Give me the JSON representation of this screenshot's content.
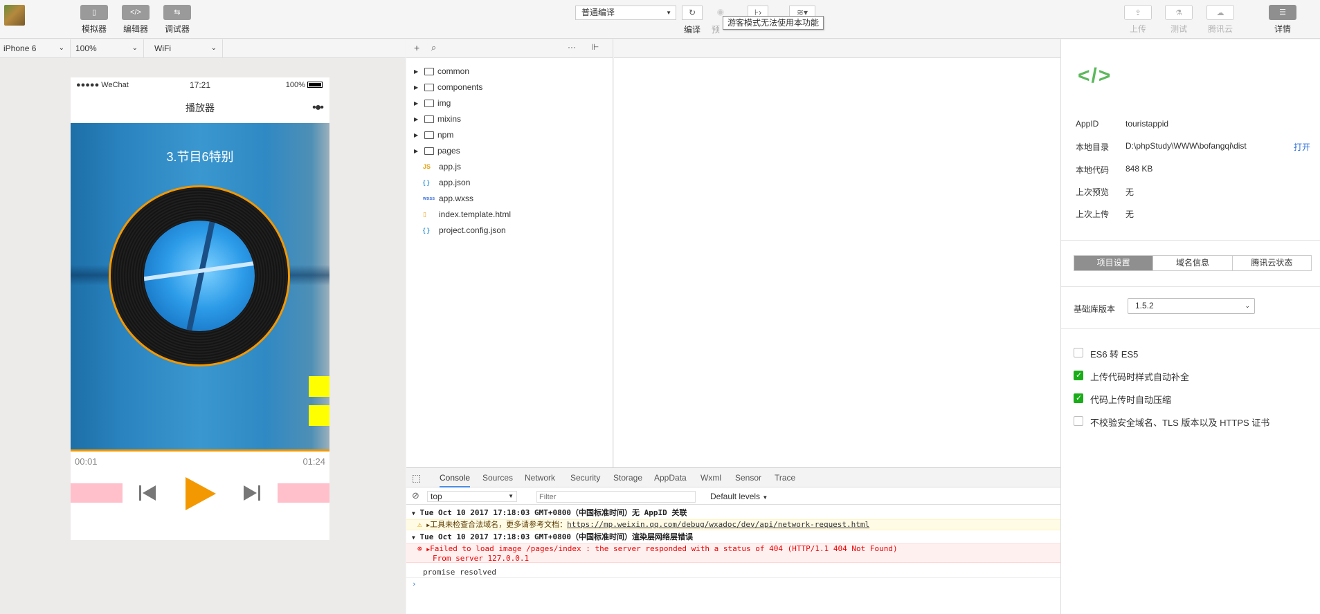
{
  "toolbar": {
    "left_buttons": [
      {
        "label": "模拟器",
        "glyph": "▯"
      },
      {
        "label": "编辑器",
        "glyph": "</>"
      },
      {
        "label": "调试器",
        "glyph": "⇆"
      }
    ],
    "mode_select": "普通编译",
    "compile_label": "编译",
    "preview_label_partial": "预",
    "tooltip": "游客模式无法使用本功能",
    "right_buttons": [
      {
        "label": "上传",
        "enabled": false
      },
      {
        "label": "测试",
        "enabled": false
      },
      {
        "label": "腾讯云",
        "enabled": false
      },
      {
        "label": "详情",
        "enabled": true
      }
    ]
  },
  "simulator": {
    "device": "iPhone 6",
    "zoom": "100%",
    "network": "WiFi",
    "status_left": "●●●●● WeChat",
    "status_time": "17:21",
    "status_battery": "100%",
    "nav_title": "播放器",
    "nav_more": "•●•",
    "song_title": "3.节目6特别",
    "time_current": "00:01",
    "time_total": "01:24"
  },
  "file_tree": {
    "folders": [
      "common",
      "components",
      "img",
      "mixins",
      "npm",
      "pages"
    ],
    "files": [
      {
        "name": "app.js",
        "icon": "JS",
        "color": "#e8a317"
      },
      {
        "name": "app.json",
        "icon": "{ }",
        "color": "#3a9ad9"
      },
      {
        "name": "app.wxss",
        "icon": "wxss",
        "color": "#3a6fd9"
      },
      {
        "name": "index.template.html",
        "icon": "▯",
        "color": "#e8a317"
      },
      {
        "name": "project.config.json",
        "icon": "{ }",
        "color": "#3a9ad9"
      }
    ]
  },
  "console": {
    "tabs": [
      "Console",
      "Sources",
      "Network",
      "Security",
      "Storage",
      "AppData",
      "Wxml",
      "Sensor",
      "Trace"
    ],
    "active_tab": "Console",
    "context": "top",
    "filter_placeholder": "Filter",
    "levels": "Default levels",
    "group1": "Tue Oct 10 2017 17:18:03 GMT+0800（中国标准时间）无 AppID 关联",
    "warn_text": "工具未检查合法域名，更多请参考文档：",
    "warn_link": "https://mp.weixin.qq.com/debug/wxadoc/dev/api/network-request.html",
    "group2": "Tue Oct 10 2017 17:18:03 GMT+0800（中国标准时间）渲染层网络层错误",
    "error_line1": "Failed to load image /pages/index : the server responded with a status of 404 (HTTP/1.1 404 Not Found)",
    "error_line2": "From server 127.0.0.1",
    "info": "promise resolved",
    "prompt": "›"
  },
  "details": {
    "logo": "</>",
    "rows": [
      {
        "k": "AppID",
        "v": "touristappid"
      },
      {
        "k": "本地目录",
        "v": "D:\\phpStudy\\WWW\\bofangqi\\dist"
      },
      {
        "k": "本地代码",
        "v": "848 KB"
      },
      {
        "k": "上次预览",
        "v": "无"
      },
      {
        "k": "上次上传",
        "v": "无"
      }
    ],
    "open_label": "打开",
    "tabs": [
      "项目设置",
      "域名信息",
      "腾讯云状态"
    ],
    "active_tab": "项目设置",
    "lib_label": "基础库版本",
    "lib_version": "1.5.2",
    "checkboxes": [
      {
        "label": "ES6 转 ES5",
        "checked": false
      },
      {
        "label": "上传代码时样式自动补全",
        "checked": true
      },
      {
        "label": "代码上传时自动压缩",
        "checked": true
      },
      {
        "label": "不校验安全域名、TLS 版本以及 HTTPS 证书",
        "checked": false
      }
    ]
  },
  "colors": {
    "accent_orange": "#f39800",
    "pink": "#ffc0cb",
    "yellow": "#ffff00",
    "link_blue": "#2a6ddb",
    "check_green": "#1aad19"
  }
}
